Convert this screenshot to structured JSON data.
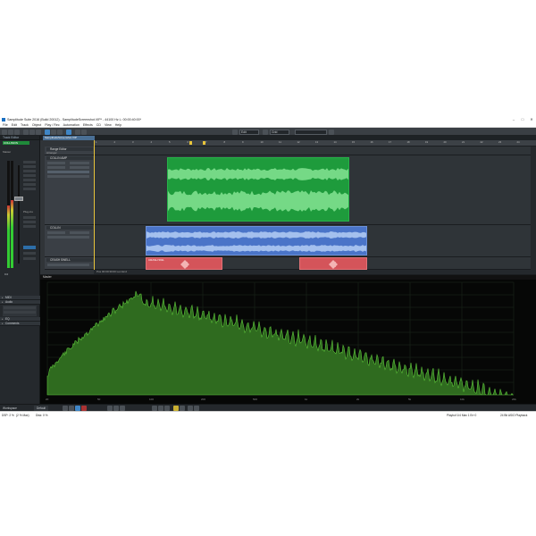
{
  "window": {
    "title": "Samplitude Suite 2016 (Build 20012) - SamplitudeScreenshot.VIP* - 44100 Hz L: 00:00:40:00*"
  },
  "menu": [
    "File",
    "Edit",
    "Track",
    "Object",
    "Play / Rec",
    "Automation",
    "Effects",
    "CD",
    "View",
    "Help"
  ],
  "toolbar": {
    "zoom_field": "Edit",
    "snap_field": "Grid"
  },
  "left_panel": {
    "header": "Track Editor",
    "track_badge": "COLLISION",
    "mixer_label": "Master",
    "slot_label": "Plug-ins",
    "value_readout": "0.0",
    "sections": [
      "MIDI",
      "Audio",
      "EQ",
      "Comments"
    ]
  },
  "arrangement": {
    "tab_label": "SamplitudeScreenshot.VIP",
    "ruler_ticks": [
      "1",
      "2",
      "3",
      "4",
      "5",
      "6",
      "7",
      "8",
      "9",
      "10",
      "11",
      "12",
      "13",
      "14",
      "15",
      "16",
      "17",
      "18",
      "19",
      "20",
      "21",
      "22",
      "23",
      "24"
    ],
    "tracks": [
      {
        "name": "Range Editor",
        "sub": "Arranger"
      },
      {
        "name": "COLLIN AMP",
        "clip_label": ""
      },
      {
        "name": "COLLIN",
        "clip_label": ""
      },
      {
        "name": "CRASH SWELL",
        "clip_label": "CRASH SWL"
      }
    ],
    "footer_text": "Pos 00:00:30:00   Len   End"
  },
  "spectrum": {
    "header_label": "Master",
    "axis_labels": [
      "20",
      "50",
      "100",
      "200",
      "500",
      "1k",
      "2k",
      "5k",
      "10k",
      "20k"
    ],
    "fill_color": "#2f6b1f",
    "line_color": "#5cc23a"
  },
  "transport": {
    "workspace_label": "Workspace",
    "workspace_value": "Default"
  },
  "status": {
    "dsp": "DSP: 2 %",
    "max": "(2 % Max)",
    "disk": "Disk: 0 %",
    "position": "Playbuf 1/4  Max 1  Err 0",
    "format": "24 Bit ASIO Playback"
  }
}
